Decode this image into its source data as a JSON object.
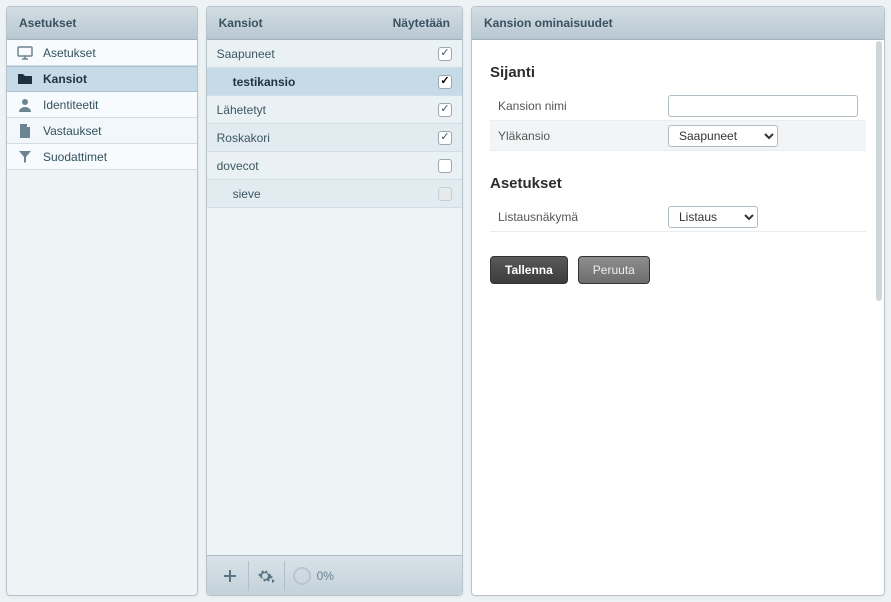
{
  "settings": {
    "header": "Asetukset",
    "items": [
      {
        "label": "Asetukset",
        "icon": "monitor"
      },
      {
        "label": "Kansiot",
        "icon": "folder",
        "active": true
      },
      {
        "label": "Identiteetit",
        "icon": "person"
      },
      {
        "label": "Vastaukset",
        "icon": "document"
      },
      {
        "label": "Suodattimet",
        "icon": "filter"
      }
    ]
  },
  "folders": {
    "header_left": "Kansiot",
    "header_right": "Näytetään",
    "rows": [
      {
        "name": "Saapuneet",
        "indent": 0,
        "checked": true,
        "strong": false,
        "disabled": false,
        "selected": false
      },
      {
        "name": "testikansio",
        "indent": 1,
        "checked": true,
        "strong": true,
        "disabled": false,
        "selected": true
      },
      {
        "name": "Lähetetyt",
        "indent": 0,
        "checked": true,
        "strong": false,
        "disabled": false,
        "selected": false
      },
      {
        "name": "Roskakori",
        "indent": 0,
        "checked": true,
        "strong": false,
        "disabled": false,
        "selected": false
      },
      {
        "name": "dovecot",
        "indent": 0,
        "checked": false,
        "strong": false,
        "disabled": false,
        "selected": false
      },
      {
        "name": "sieve",
        "indent": 1,
        "checked": false,
        "strong": false,
        "disabled": true,
        "selected": false
      }
    ],
    "quota_text": "0%"
  },
  "props": {
    "header": "Kansion ominaisuudet",
    "section_location": "Sijanti",
    "section_settings": "Asetukset",
    "name_label": "Kansion nimi",
    "name_value": "",
    "parent_label": "Yläkansio",
    "parent_selected": "Saapuneet",
    "view_label": "Listausnäkymä",
    "view_selected": "Listaus",
    "save_label": "Tallenna",
    "cancel_label": "Peruuta"
  }
}
